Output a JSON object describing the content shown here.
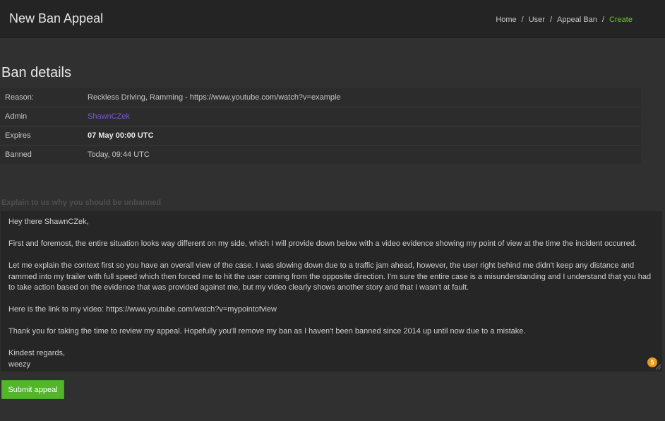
{
  "header": {
    "title": "New Ban Appeal",
    "breadcrumb": {
      "items": [
        "Home",
        "User",
        "Appeal Ban"
      ],
      "current": "Create",
      "separator": "/"
    }
  },
  "ban_details": {
    "title": "Ban details",
    "rows": [
      {
        "label": "Reason:",
        "value": "Reckless Driving, Ramming - https://www.youtube.com/watch?v=example"
      },
      {
        "label": "Admin",
        "value": "ShawnCZek"
      },
      {
        "label": "Expires",
        "value": "07 May 00:00 UTC"
      },
      {
        "label": "Banned",
        "value": "Today, 09:44 UTC"
      }
    ]
  },
  "appeal_form": {
    "label": "Explain to us why you should be unbanned",
    "paragraphs": [
      "Hey there ShawnCZek,",
      "First and foremost, the entire situation looks way different on my side, which I will provide down below with a video evidence showing my point of view at the time the incident occurred.",
      "Let me explain the context first so you have an overall view of the case. I was slowing down due to a traffic jam ahead, however, the user right behind me didn't keep any distance and rammed into my trailer with full speed which then forced me to hit the user coming from the opposite direction. I'm sure the entire case is a misunderstanding and I understand that you had to take action based on the evidence that was provided against me, but my video clearly shows another story and that I wasn't at fault.",
      "Here is the link to my video: https://www.youtube.com/watch?v=mypointofview",
      "Thank you for taking the time to review my appeal. Hopefully you'll remove my ban as I haven't been banned since 2014 up until now due to a mistake."
    ],
    "sign_off": [
      "Kindest regards,",
      "weezy"
    ],
    "badge_count": "5",
    "submit_label": "Submit appeal"
  },
  "colors": {
    "background": "#303030",
    "header": "#242424",
    "accent_green": "#52b52a",
    "breadcrumb_current": "#6cc33c",
    "link_purple": "#7a55d8",
    "badge_orange": "#e89a1c"
  }
}
